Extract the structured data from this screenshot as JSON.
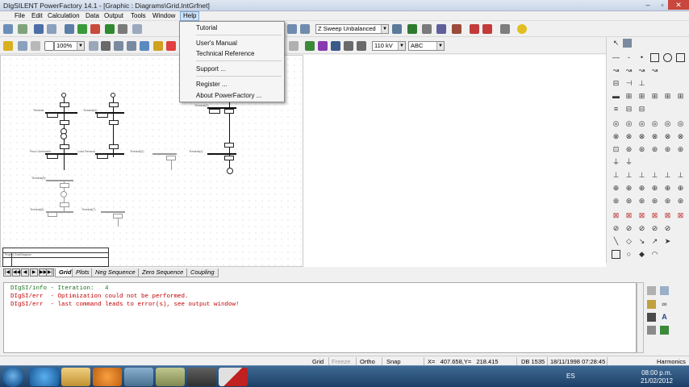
{
  "window": {
    "title": "DIgSILENT PowerFactory 14.1 - [Graphic : Diagrams\\Grid.IntGrfnet]",
    "minimize": "–",
    "maximize": "▫",
    "close": "✕"
  },
  "menubar": {
    "items": [
      "File",
      "Edit",
      "Calculation",
      "Data",
      "Output",
      "Tools",
      "Window",
      "Help"
    ]
  },
  "help_menu": {
    "items": [
      "Tutorial",
      "User's Manual",
      "Technical Reference",
      "Support ...",
      "Register ...",
      "About PowerFactory ..."
    ]
  },
  "toolbar1": {
    "study_case": "Z Sweep Unbalanced"
  },
  "toolbar2": {
    "zoom": "100%",
    "voltage": "110 kV",
    "phase": "ABC"
  },
  "diagram": {
    "labels": [
      "Terminal",
      "Terminal(1)",
      "Terminal(2)",
      "Terminal(3)",
      "Terminal(4)",
      "Load Terminal",
      "Terminal(5)",
      "Terminal(6)",
      "Terminal(7)",
      "Terminal(8)",
      "Pisco Generador"
    ],
    "legend_title": "Project Grid/Diagram"
  },
  "tabs": {
    "items": [
      "Grid",
      "Plots",
      "Neg Sequence",
      "Zero Sequence",
      "Coupling"
    ],
    "selected": "Grid"
  },
  "output": {
    "lines": [
      {
        "text": "DIgSI/info - Iteration:   4",
        "color": "#1a6f1a"
      },
      {
        "text": "DIgSI/err  - Optimization could not be performed.",
        "color": "#c00000"
      },
      {
        "text": "DIgSI/err  - last command leads to error(s), see output window!",
        "color": "#c00000"
      }
    ]
  },
  "statusbar": {
    "grid": "Grid",
    "freeze": "Freeze",
    "ortho": "Ortho",
    "snap": "Snap",
    "coords": "X=   407.658,Y=   218.415",
    "db": "DB 1535",
    "datetime": "18/11/1998 07:28:45",
    "mode": "Harmonics"
  },
  "taskbar": {
    "language": "ES",
    "time": "08:00 p.m.",
    "date": "21/02/2012"
  },
  "colors": {
    "info": "#1a6f1a",
    "error": "#c00000",
    "taskbar": "#2a5582"
  }
}
